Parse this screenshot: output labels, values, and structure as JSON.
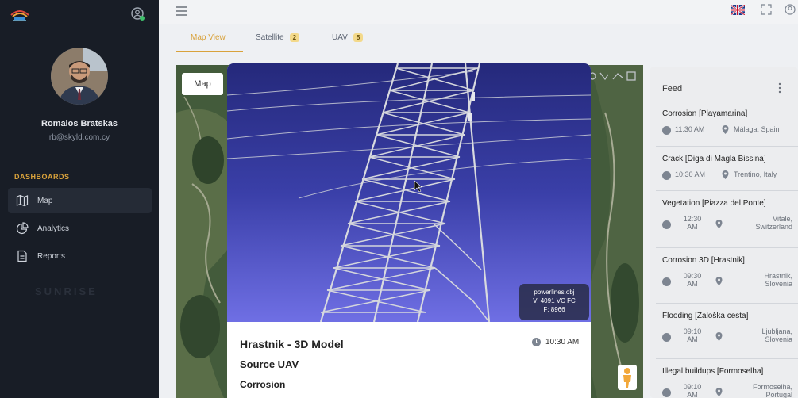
{
  "user": {
    "name": "Romaios Bratskas",
    "email": "rb@skyld.com.cy"
  },
  "sidebar": {
    "section": "DASHBOARDS",
    "items": [
      {
        "label": "Map",
        "icon": "map-icon"
      },
      {
        "label": "Analytics",
        "icon": "pie-chart-icon"
      },
      {
        "label": "Reports",
        "icon": "document-icon"
      }
    ],
    "watermark": "SUNRISE"
  },
  "tabs": [
    {
      "label": "Map View"
    },
    {
      "label": "Satellite",
      "badge": "2"
    },
    {
      "label": "UAV",
      "badge": "5"
    }
  ],
  "map": {
    "button_label": "Map"
  },
  "modal": {
    "model_file": "powerlines.obj",
    "model_stats": "V: 4091 VC FC",
    "model_faces": "F: 8966",
    "title": "Hrastnik - 3D Model",
    "time": "10:30 AM",
    "source": "Source UAV",
    "type": "Corrosion"
  },
  "feed": {
    "title": "Feed",
    "items": [
      {
        "title": "Corrosion [Playamarina]",
        "time": "11:30 AM",
        "location": "Málaga, Spain"
      },
      {
        "title": "Crack [Diga di Magla Bissina]",
        "time": "10:30 AM",
        "location": "Trentino, Italy"
      },
      {
        "title": "Vegetation [Piazza del Ponte]",
        "time": "12:30 AM",
        "location": "Vitale, Switzerland"
      },
      {
        "title": "Corrosion 3D [Hrastnik]",
        "time": "09:30 AM",
        "location": "Hrastnik, Slovenia"
      },
      {
        "title": "Flooding [Zaloška cesta]",
        "time": "09:10 AM",
        "location": "Ljubljana, Slovenia"
      },
      {
        "title": "Illegal buildups [Formoselha]",
        "time": "09:10 AM",
        "location": "Formoselha, Portugal"
      }
    ]
  },
  "colors": {
    "accent": "#d9a23b",
    "sidebar": "#181d26",
    "badge": "#f3d98a"
  }
}
